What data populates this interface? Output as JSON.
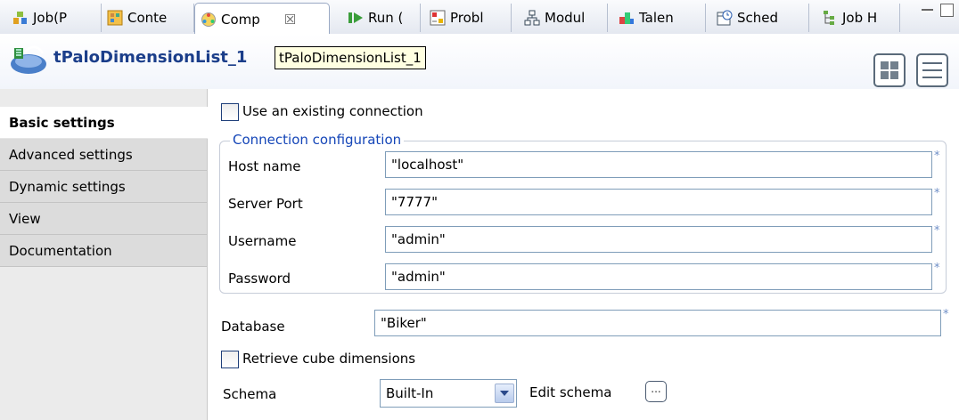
{
  "tabs": [
    {
      "label": "Job(P",
      "icon": "job-icon"
    },
    {
      "label": "Conte",
      "icon": "context-icon"
    },
    {
      "label": "Comp",
      "icon": "component-icon",
      "active": true
    },
    {
      "label": "Run (",
      "icon": "run-icon"
    },
    {
      "label": "Probl",
      "icon": "problems-icon"
    },
    {
      "label": "Modul",
      "icon": "modules-icon"
    },
    {
      "label": "Talen",
      "icon": "talend-icon"
    },
    {
      "label": "Sched",
      "icon": "scheduler-icon"
    },
    {
      "label": "Job H",
      "icon": "job-hierarchy-icon"
    }
  ],
  "header": {
    "title": "tPaloDimensionList_1",
    "tooltip": "tPaloDimensionList_1"
  },
  "sidenav": {
    "items": [
      {
        "label": "Basic settings",
        "active": true
      },
      {
        "label": "Advanced settings"
      },
      {
        "label": "Dynamic settings"
      },
      {
        "label": "View"
      },
      {
        "label": "Documentation"
      }
    ]
  },
  "form": {
    "use_existing_connection": {
      "label": "Use an existing connection",
      "checked": false
    },
    "connection_group_label": "Connection configuration",
    "host_name": {
      "label": "Host name",
      "value": "\"localhost\""
    },
    "server_port": {
      "label": "Server Port",
      "value": "\"7777\""
    },
    "username": {
      "label": "Username",
      "value": "\"admin\""
    },
    "password": {
      "label": "Password",
      "value": "\"admin\""
    },
    "database": {
      "label": "Database",
      "value": "\"Biker\""
    },
    "retrieve_cube_dimensions": {
      "label": "Retrieve cube dimensions",
      "checked": false
    },
    "schema": {
      "label": "Schema",
      "value": "Built-In"
    },
    "edit_schema_label": "Edit schema",
    "edit_schema_button": "...",
    "required_mark": "*"
  },
  "colors": {
    "title": "#1b3e8a",
    "legend": "#1546b8",
    "tooltip_bg": "#ffffe1"
  }
}
